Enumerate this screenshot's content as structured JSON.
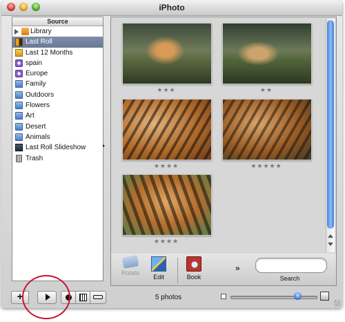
{
  "window": {
    "title": "iPhoto"
  },
  "source": {
    "header": "Source",
    "items": [
      {
        "label": "Library",
        "icon": "library-icon",
        "kind": "library",
        "selected": false
      },
      {
        "label": "Last Roll",
        "icon": "film-roll-icon",
        "kind": "roll",
        "selected": true
      },
      {
        "label": "Last 12 Months",
        "icon": "calendar-icon",
        "kind": "months",
        "selected": false
      },
      {
        "label": "spain",
        "icon": "smart-album-icon",
        "kind": "smart",
        "selected": false
      },
      {
        "label": "Europe",
        "icon": "smart-album-icon",
        "kind": "smart",
        "selected": false
      },
      {
        "label": "Family",
        "icon": "album-icon",
        "kind": "album",
        "selected": false
      },
      {
        "label": "Outdoors",
        "icon": "album-icon",
        "kind": "album",
        "selected": false
      },
      {
        "label": "Flowers",
        "icon": "album-icon",
        "kind": "album",
        "selected": false
      },
      {
        "label": "Art",
        "icon": "album-icon",
        "kind": "album",
        "selected": false
      },
      {
        "label": "Desert",
        "icon": "album-icon",
        "kind": "album",
        "selected": false
      },
      {
        "label": "Animals",
        "icon": "album-icon",
        "kind": "album",
        "selected": false
      },
      {
        "label": "Last Roll Slideshow",
        "icon": "slideshow-icon",
        "kind": "slide",
        "selected": false
      },
      {
        "label": "Trash",
        "icon": "trash-icon",
        "kind": "trash",
        "selected": false
      }
    ]
  },
  "photos": [
    {
      "stars": "★★★",
      "rating": 3
    },
    {
      "stars": "★★",
      "rating": 2
    },
    {
      "stars": "★★★★",
      "rating": 4
    },
    {
      "stars": "★★★★★",
      "rating": 5
    },
    {
      "stars": "★★★★",
      "rating": 4
    }
  ],
  "toolbar": {
    "rotate_label": "Rotate",
    "edit_label": "Edit",
    "book_label": "Book",
    "more_label": "»",
    "search_label": "Search",
    "search_value": ""
  },
  "status": {
    "photo_count": "5 photos",
    "zoom_level": 0.78
  },
  "buttons": {
    "add": "+"
  },
  "colors": {
    "selection": "#6f7f9b",
    "accent_blue": "#3f7fd9",
    "highlight_circle": "#c8102e"
  }
}
